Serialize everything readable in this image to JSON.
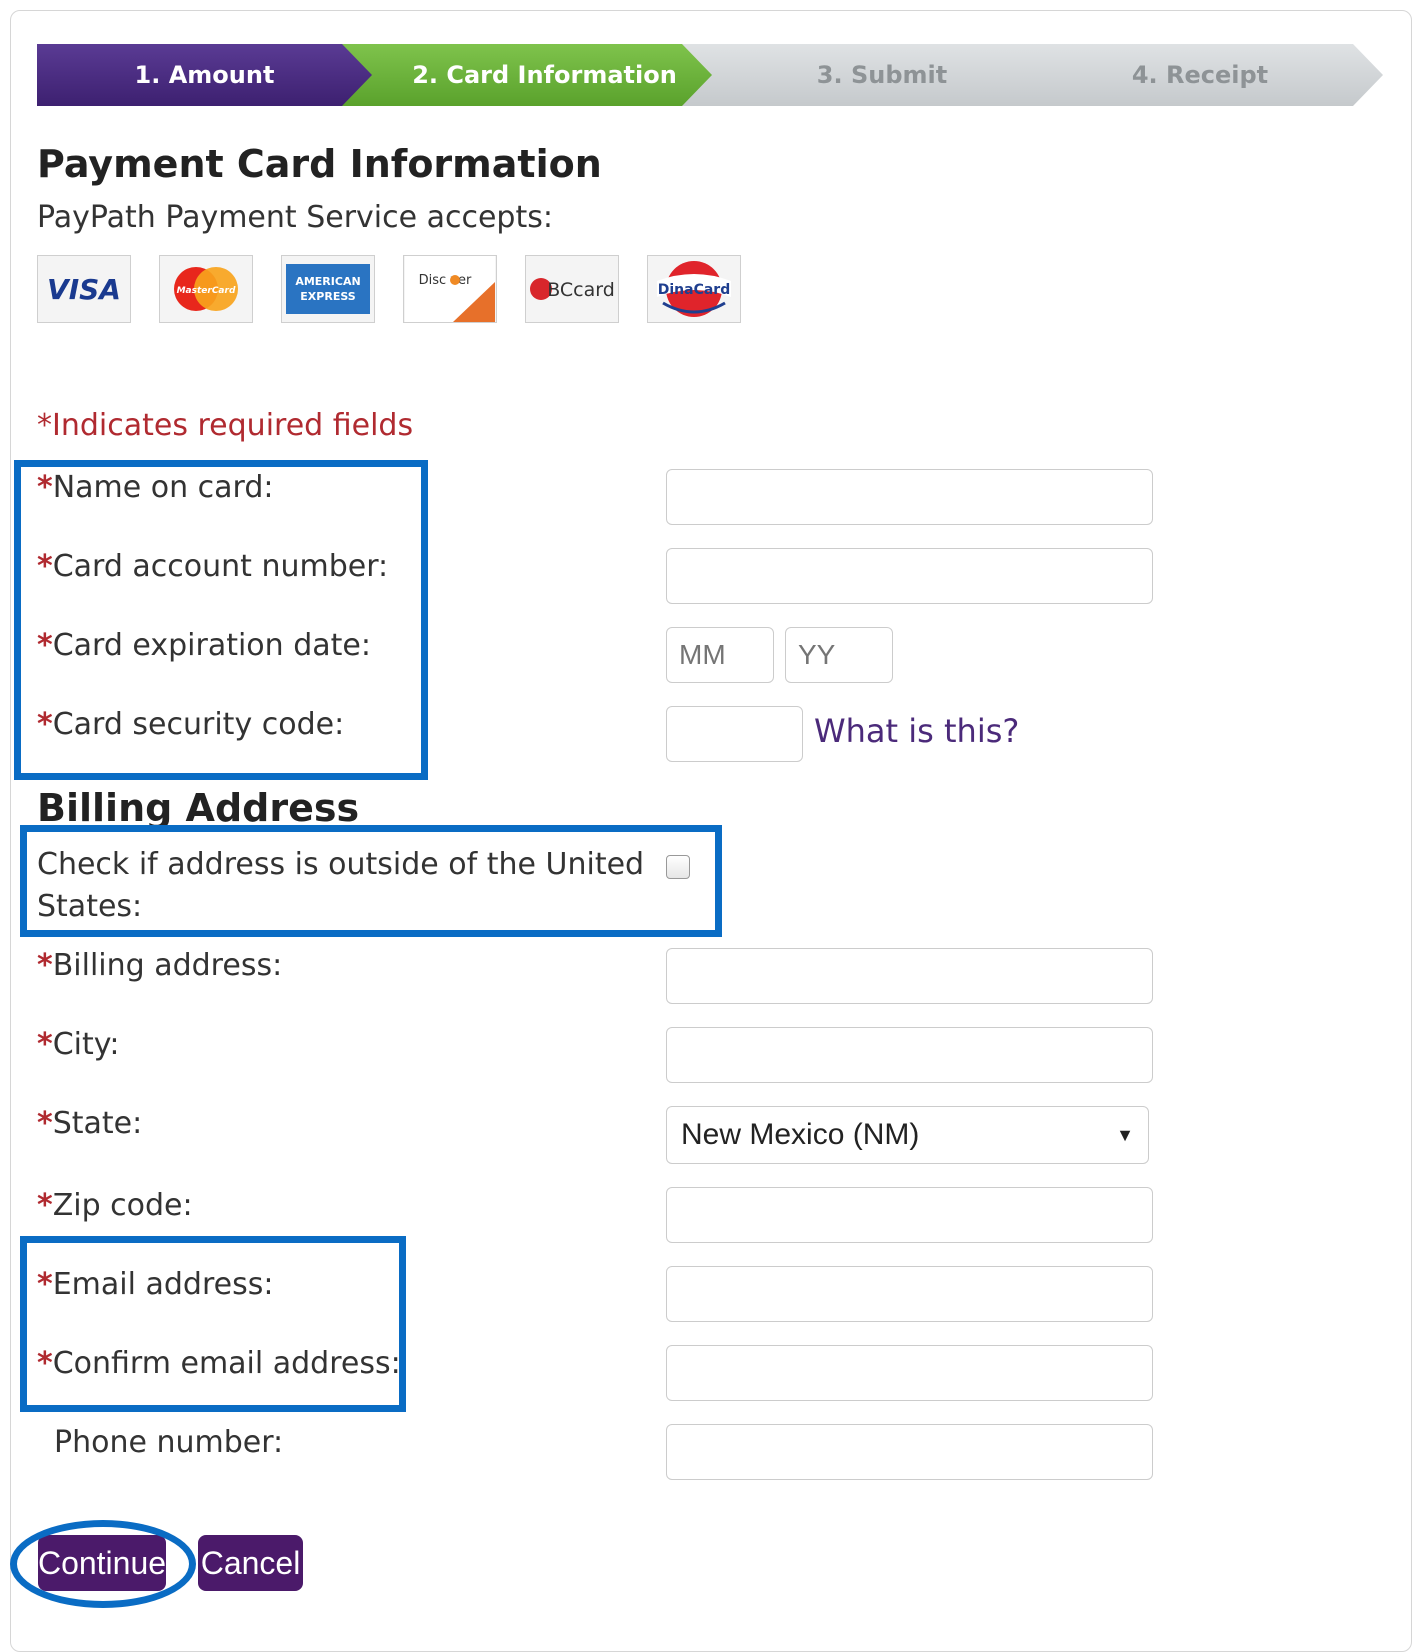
{
  "stepper": {
    "steps": [
      {
        "label": "1. Amount",
        "state": "complete"
      },
      {
        "label": "2. Card Information",
        "state": "active"
      },
      {
        "label": "3. Submit",
        "state": "pending"
      },
      {
        "label": "4. Receipt",
        "state": "pending"
      }
    ]
  },
  "header": {
    "title": "Payment Card Information",
    "accepts": "PayPath Payment Service accepts:"
  },
  "card_logos": [
    {
      "name": "VISA",
      "icon": "visa-icon"
    },
    {
      "name": "MasterCard",
      "icon": "mastercard-icon"
    },
    {
      "name": "AMERICAN EXPRESS",
      "icon": "amex-icon"
    },
    {
      "name": "DISCOVER",
      "icon": "discover-icon"
    },
    {
      "name": "BCcard",
      "icon": "bccard-icon"
    },
    {
      "name": "DinaCard",
      "icon": "dinacard-icon"
    }
  ],
  "required_note": "*Indicates required fields",
  "card_section": {
    "name_label": "Name on card:",
    "number_label": "Card account number:",
    "expiry_label": "Card expiration date:",
    "expiry_month_placeholder": "MM",
    "expiry_year_placeholder": "YY",
    "cvv_label": "Card security code:",
    "cvv_help": "What is this?"
  },
  "billing": {
    "heading": "Billing Address",
    "outside_us_label_line1": "Check if address is outside of the United",
    "outside_us_label_line2": "States:",
    "address_label": "Billing address:",
    "city_label": "City:",
    "state_label": "State:",
    "state_value": "New Mexico (NM)",
    "zip_label": "Zip code:",
    "email_label": "Email address:",
    "confirm_email_label": "Confirm email address:",
    "phone_label": "Phone number:"
  },
  "asterisk": "*",
  "actions": {
    "continue_label": "Continue",
    "cancel_label": "Cancel"
  },
  "colors": {
    "step_complete": "#3d2070",
    "step_active": "#5aa22c",
    "step_pending": "#c5c9cc",
    "required": "#b02a30",
    "highlight": "#0a6cc4",
    "button": "#4b1a6a"
  }
}
